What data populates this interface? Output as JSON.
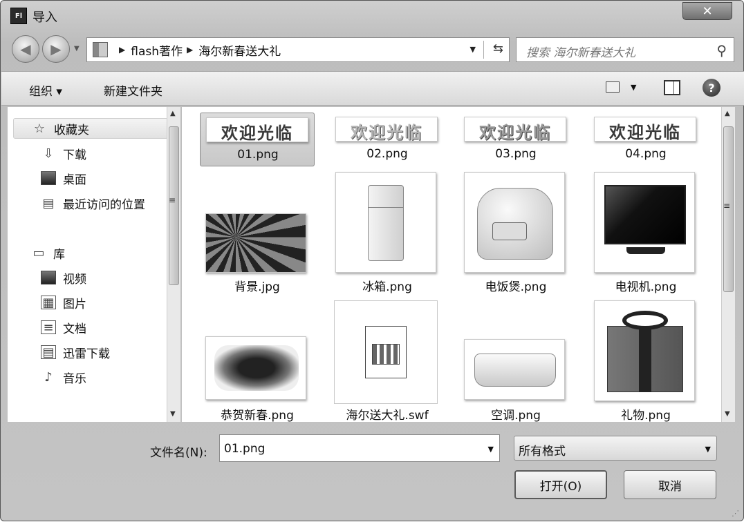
{
  "window": {
    "title": "导入",
    "app_icon": "Fl",
    "close_icon": "close-icon"
  },
  "nav": {
    "breadcrumb": [
      "flash著作",
      "海尔新春送大礼"
    ],
    "search_placeholder": "搜索 海尔新春送大礼"
  },
  "toolbar": {
    "organize_label": "组织 ▾",
    "new_folder_label": "新建文件夹",
    "help_label": "?"
  },
  "sidebar": {
    "favorites_label": "收藏夹",
    "favorites": [
      "下载",
      "桌面",
      "最近访问的位置"
    ],
    "library_label": "库",
    "library": [
      "视频",
      "图片",
      "文档",
      "迅雷下载",
      "音乐"
    ]
  },
  "files": [
    {
      "name": "01.png",
      "selected": true
    },
    {
      "name": "02.png"
    },
    {
      "name": "03.png"
    },
    {
      "name": "04.png"
    },
    {
      "name": "背景.jpg"
    },
    {
      "name": "冰箱.png"
    },
    {
      "name": "电饭煲.png"
    },
    {
      "name": "电视机.png"
    },
    {
      "name": "恭贺新春.png"
    },
    {
      "name": "海尔送大礼.swf"
    },
    {
      "name": "空调.png"
    },
    {
      "name": "礼物.png"
    }
  ],
  "banner_text": "欢迎光临",
  "file_name": {
    "label": "文件名(N):",
    "value": "01.png"
  },
  "file_type": "所有格式",
  "buttons": {
    "open": "打开(O)",
    "cancel": "取消"
  }
}
